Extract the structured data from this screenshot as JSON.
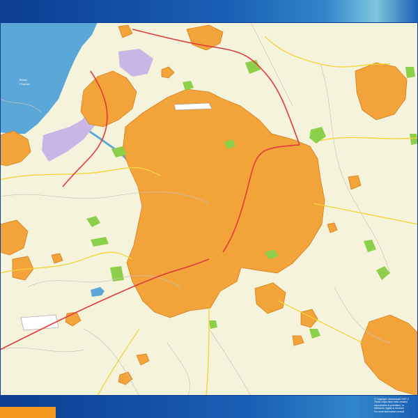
{
  "map": {
    "water_label_line1": "Bristol",
    "water_label_line2": "Channel",
    "colors": {
      "background": "#f6f3dc",
      "water": "#5aa7d8",
      "urban": "#f2a33a",
      "urban_edge": "#d47f1c",
      "park": "#8ccf4a",
      "industrial": "#c9b6e6",
      "motorway": "#e03a3a",
      "primary_road": "#f3d43a",
      "minor_road": "#c9c3b5",
      "frame_dark": "#0b3d91",
      "frame_light": "#7fc6dd",
      "tab": "#f39a1e"
    }
  },
  "copyright": {
    "line1": "© Copyright: Ubukeeyard  1997-2",
    "line2": "These maps have been created",
    "line3": "reproduction is prohibited, in",
    "line4": "electronic, digital or mechani",
    "line5": "For more information consult"
  }
}
